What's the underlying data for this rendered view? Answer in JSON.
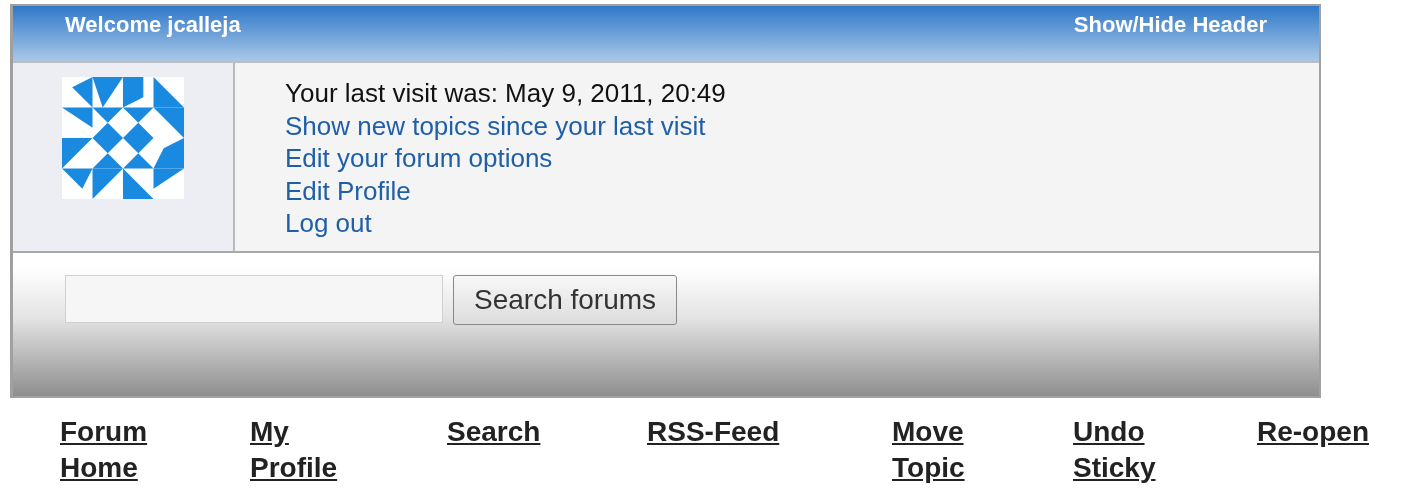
{
  "header": {
    "welcome": "Welcome jcalleja",
    "toggle": "Show/Hide Header"
  },
  "user_panel": {
    "last_visit": "Your last visit was: May 9, 2011, 20:49",
    "links": [
      "Show new topics since your last visit",
      "Edit your forum options",
      "Edit Profile",
      "Log out"
    ]
  },
  "search": {
    "button": "Search forums"
  },
  "nav": [
    "Forum Home",
    "My Profile",
    "Search",
    "RSS-Feed",
    "Move Topic",
    "Undo Sticky",
    "Re-open"
  ]
}
